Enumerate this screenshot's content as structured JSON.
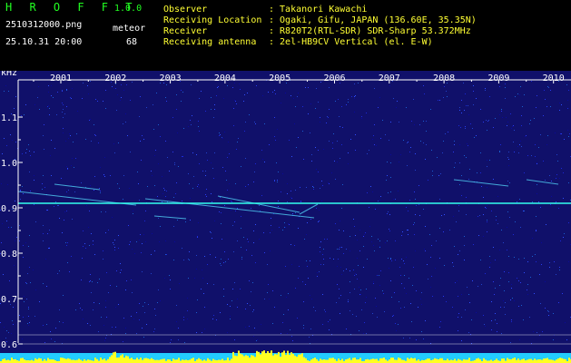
{
  "header": {
    "app_title": "H R O F F T",
    "app_version": "1.0.0",
    "filename": "2510312000.png",
    "meteor_label": "meteor",
    "datetime": "25.10.31 20:00",
    "meteor_count": "68"
  },
  "info": [
    {
      "key": "Observer",
      "value": ": Takanori Kawachi"
    },
    {
      "key": "Receiving Location",
      "value": ": Ogaki, Gifu, JAPAN (136.60E, 35.35N)"
    },
    {
      "key": "Receiver",
      "value": ": R820T2(RTL-SDR) SDR-Sharp 53.372MHz"
    },
    {
      "key": "Receiving antenna",
      "value": ": 2el-HB9CV Vertical (el. E-W)"
    }
  ],
  "spectrogram": {
    "y_unit": "kHz",
    "x_ticks": [
      "2001",
      "2002",
      "2003",
      "2004",
      "2005",
      "2006",
      "2007",
      "2008",
      "2009",
      "2010"
    ],
    "y_ticks": [
      "1.1",
      "1.0",
      "0.9",
      "0.8",
      "0.7",
      "0.6"
    ],
    "carrier_khz": 0.91,
    "colors": {
      "background": "#10106a",
      "axis": "#ffffff",
      "carrier": "#33ffee",
      "meteor": "#55ddff",
      "bottom_bar": "#22ccff",
      "signal_bars": "#ffff22"
    }
  }
}
